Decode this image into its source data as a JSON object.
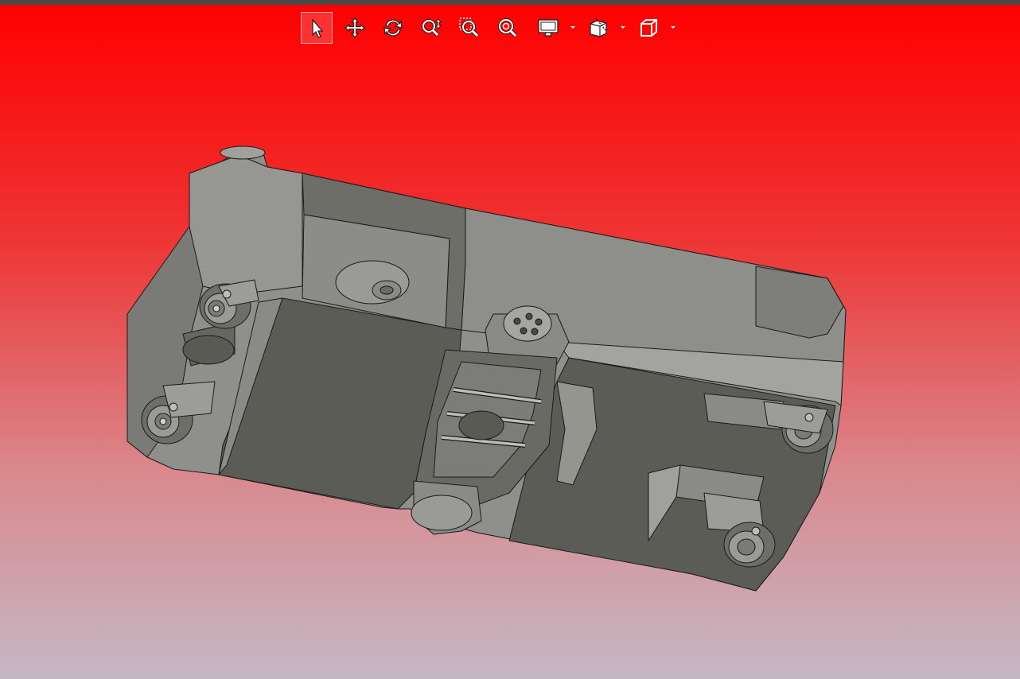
{
  "viewport": {
    "background_top_color": "#ff0000",
    "background_bottom_color": "#c4b8c4",
    "model_part_color": "#8f8f8b",
    "model_dark_color": "#5a5a55",
    "model_edge_color": "#1a1a1a"
  },
  "toolbar": {
    "tools": [
      {
        "name": "select",
        "icon": "cursor-arrow-icon",
        "active": true
      },
      {
        "name": "pan",
        "icon": "move-arrows-icon",
        "active": false
      },
      {
        "name": "rotate",
        "icon": "rotate-icon",
        "active": false
      },
      {
        "name": "zoom",
        "icon": "zoom-updown-icon",
        "active": false
      },
      {
        "name": "zoom-window",
        "icon": "zoom-window-icon",
        "active": false
      },
      {
        "name": "zoom-fit",
        "icon": "zoom-fit-icon",
        "active": false
      },
      {
        "name": "display-mode",
        "icon": "monitor-icon",
        "active": false,
        "has_dropdown": true
      },
      {
        "name": "section-view",
        "icon": "section-cube-icon",
        "active": false,
        "has_dropdown": true
      },
      {
        "name": "standard-views",
        "icon": "cube-icon",
        "active": false,
        "has_dropdown": true
      }
    ]
  }
}
